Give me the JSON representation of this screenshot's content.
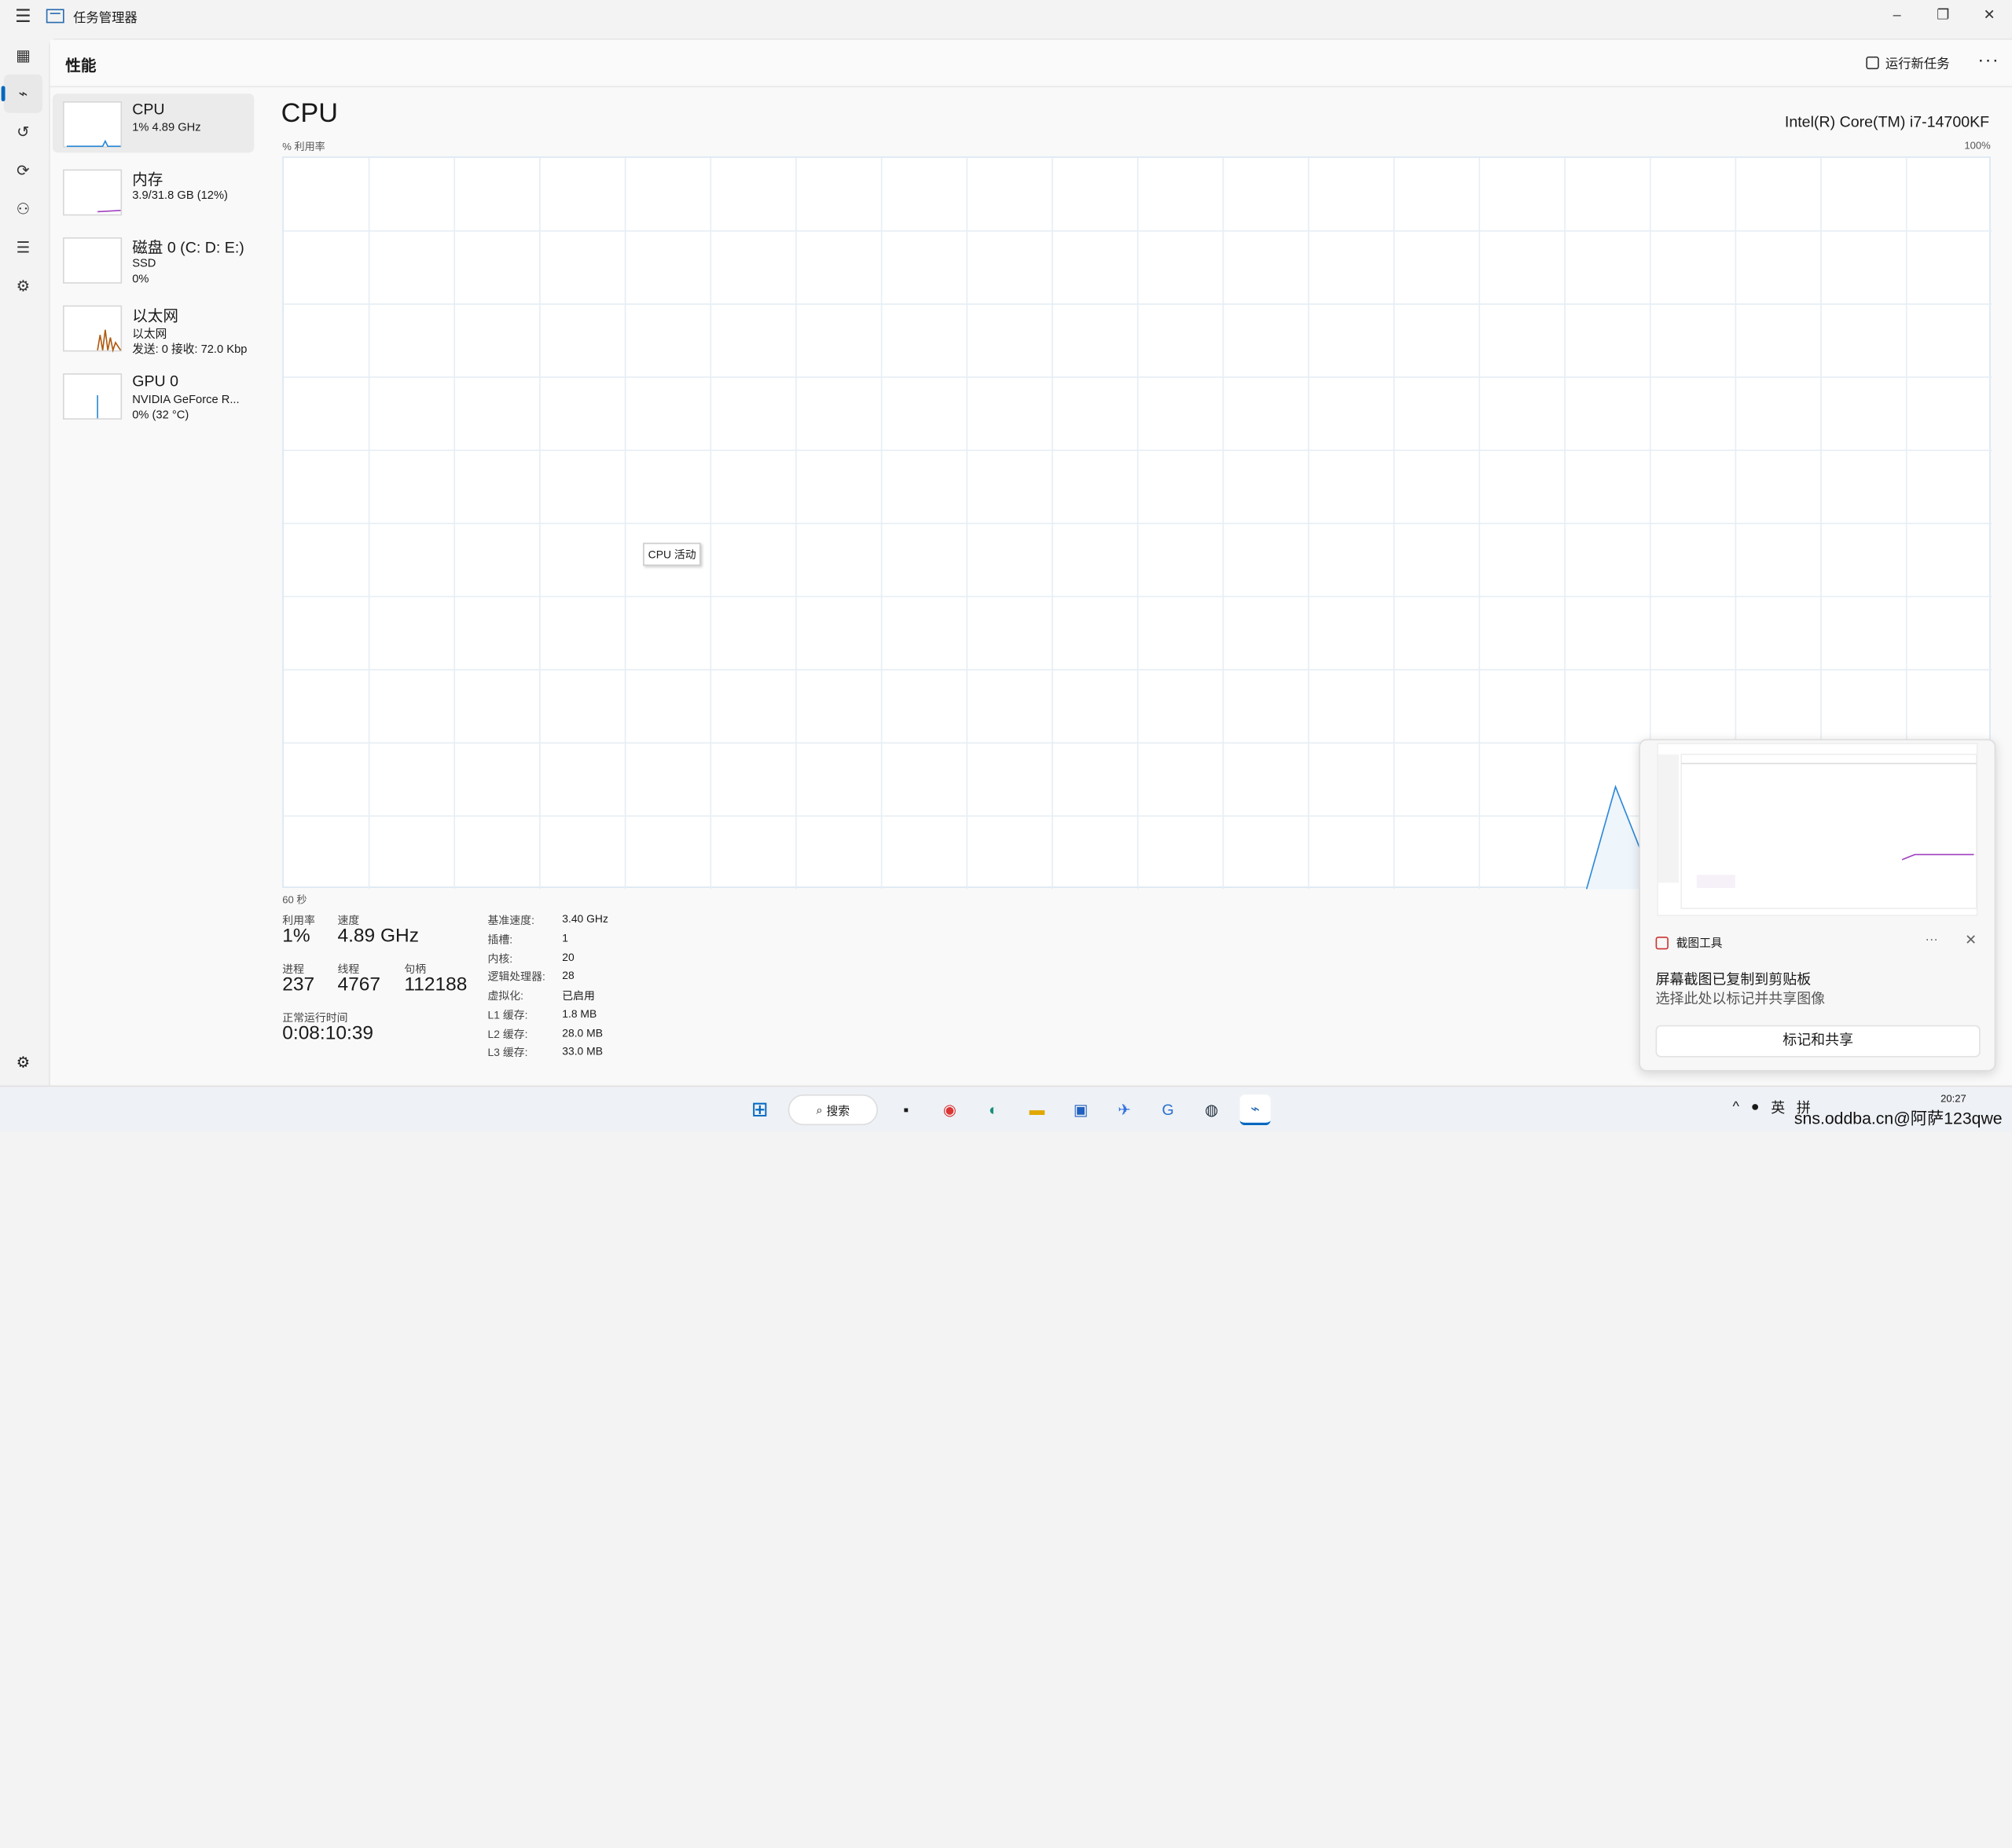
{
  "window": {
    "title": "任务管理器",
    "min": "–",
    "max": "❐",
    "close": "✕"
  },
  "header": {
    "page_title": "性能",
    "run_task_label": "运行新任务",
    "more_label": "···"
  },
  "side_devices": [
    {
      "name": "CPU",
      "sub1": "1% 4.89 GHz",
      "sub2": ""
    },
    {
      "name": "内存",
      "sub1": "3.9/31.8 GB (12%)",
      "sub2": ""
    },
    {
      "name": "磁盘 0 (C: D: E:)",
      "sub1": "SSD",
      "sub2": "0%"
    },
    {
      "name": "以太网",
      "sub1": "以太网",
      "sub2": "发送: 0 接收: 72.0 Kbp"
    },
    {
      "name": "GPU 0",
      "sub1": "NVIDIA GeForce R...",
      "sub2": "0% (32 °C)"
    }
  ],
  "main": {
    "title": "CPU",
    "model": "Intel(R) Core(TM) i7-14700KF",
    "axis_top_left": "% 利用率",
    "axis_top_right": "100%",
    "axis_bottom_left": "60 秒",
    "tooltip": "CPU 活动"
  },
  "stats": {
    "util_label": "利用率",
    "util_value": "1%",
    "speed_label": "速度",
    "speed_value": "4.89 GHz",
    "proc_label": "进程",
    "proc_value": "237",
    "thread_label": "线程",
    "thread_value": "4767",
    "handle_label": "句柄",
    "handle_value": "112188",
    "uptime_label": "正常运行时间",
    "uptime_value": "0:08:10:39"
  },
  "specs": [
    {
      "k": "基准速度:",
      "v": "3.40 GHz"
    },
    {
      "k": "插槽:",
      "v": "1"
    },
    {
      "k": "内核:",
      "v": "20"
    },
    {
      "k": "逻辑处理器:",
      "v": "28"
    },
    {
      "k": "虚拟化:",
      "v": "已启用"
    },
    {
      "k": "L1 缓存:",
      "v": "1.8 MB"
    },
    {
      "k": "L2 缓存:",
      "v": "28.0 MB"
    },
    {
      "k": "L3 缓存:",
      "v": "33.0 MB"
    }
  ],
  "cpu_graph": {
    "ylim": [
      0,
      100
    ],
    "points": [
      0,
      0,
      0,
      0,
      0,
      0,
      0,
      0,
      0,
      0,
      0,
      0,
      0,
      0,
      0,
      0,
      0,
      0,
      0,
      0,
      0,
      0,
      0,
      0,
      0,
      0,
      0,
      0,
      0,
      0,
      0,
      0,
      0,
      0,
      0,
      0,
      0,
      0,
      0,
      0,
      0,
      0,
      0,
      0,
      0,
      0,
      14,
      4,
      4,
      3,
      3,
      3,
      4,
      3,
      3,
      3,
      3,
      3,
      3,
      4
    ]
  },
  "toast": {
    "app": "截图工具",
    "title": "屏幕截图已复制到剪贴板",
    "subtitle": "选择此处以标记并共享图像",
    "button": "标记和共享",
    "more": "···",
    "close": "✕"
  },
  "taskbar": {
    "search_label": "搜索",
    "tray_lang": "英",
    "tray_ime": "拼",
    "time": "20:27",
    "watermark": "sns.oddba.cn@阿萨123qwe"
  }
}
